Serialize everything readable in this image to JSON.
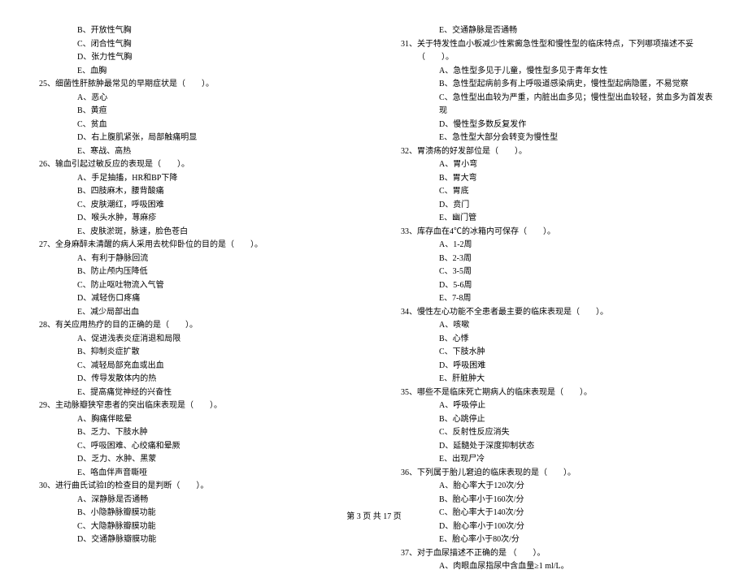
{
  "leftColumn": {
    "preOptions": [
      "B、开放性气胸",
      "C、闭合性气胸",
      "D、张力性气胸",
      "E、血胸"
    ],
    "questions": [
      {
        "num": "25、",
        "stem": "细菌性肝脓肿最常见的早期症状是（　　）。",
        "options": [
          "A、恶心",
          "B、黄疸",
          "C、贫血",
          "D、右上腹肌紧张，局部触痛明显",
          "E、寒战、高热"
        ]
      },
      {
        "num": "26、",
        "stem": "输血引起过敏反应的表现是（　　）。",
        "options": [
          "A、手足抽搐，HR和BP下降",
          "B、四肢麻木，腰背酸痛",
          "C、皮肤潮红，呼吸困难",
          "D、喉头水肿，荨麻疹",
          "E、皮肤淤斑，脉速，脸色苍白"
        ]
      },
      {
        "num": "27、",
        "stem": "全身麻醉未清醒的病人采用去枕仰卧位的目的是（　　）。",
        "options": [
          "A、有利于静脉回流",
          "B、防止颅内压降低",
          "C、防止呕吐物流入气管",
          "D、减轻伤口疼痛",
          "E、减少局部出血"
        ]
      },
      {
        "num": "28、",
        "stem": "有关应用热疗的目的正确的是（　　）。",
        "options": [
          "A、促进浅表炎症消退和局限",
          "B、抑制炎症扩散",
          "C、减轻局部充血或出血",
          "D、传导发散体内的热",
          "E、提高痛觉神经的兴奋性"
        ]
      },
      {
        "num": "29、",
        "stem": "主动脉瓣狭窄患者的突出临床表现是（　　）。",
        "options": [
          "A、胸痛伴眩晕",
          "B、乏力、下肢水肿",
          "C、呼吸困难、心绞痛和晕厥",
          "D、乏力、水肿、黑蒙",
          "E、咯血伴声音嘶哑"
        ]
      },
      {
        "num": "30、",
        "stem": "进行曲氏试验I的检查目的是判断（　　）。",
        "options": [
          "A、深静脉是否通畅",
          "B、小隐静脉瓣膜功能",
          "C、大隐静脉瓣膜功能",
          "D、交通静脉瓣膜功能"
        ]
      }
    ]
  },
  "rightColumn": {
    "preOptions": [
      "E、交通静脉是否通畅"
    ],
    "questions": [
      {
        "num": "31、",
        "stem": "关于特发性血小板减少性紫癜急性型和慢性型的临床特点，下列哪项描述不妥（　　）。",
        "options": [
          "A、急性型多见于儿童，慢性型多见于青年女性",
          "B、急性型起病前多有上呼吸道感染病史，慢性型起病隐匿，不易觉察",
          "C、急性型出血较为严重，内脏出血多见；慢性型出血较轻，贫血多为首发表现",
          "D、慢性型多数反复发作",
          "E、急性型大部分会转变为慢性型"
        ]
      },
      {
        "num": "32、",
        "stem": "胃溃疡的好发部位是（　　）。",
        "options": [
          "A、胃小弯",
          "B、胃大弯",
          "C、胃底",
          "D、贲门",
          "E、幽门管"
        ]
      },
      {
        "num": "33、",
        "stem": "库存血在4℃的冰箱内可保存（　　）。",
        "options": [
          "A、1-2周",
          "B、2-3周",
          "C、3-5周",
          "D、5-6周",
          "E、7-8周"
        ]
      },
      {
        "num": "34、",
        "stem": "慢性左心功能不全患者最主要的临床表现是（　　）。",
        "options": [
          "A、咳嗽",
          "B、心悸",
          "C、下肢水肿",
          "D、呼吸困难",
          "E、肝脏肿大"
        ]
      },
      {
        "num": "35、",
        "stem": "哪些不是临床死亡期病人的临床表现是（　　）。",
        "options": [
          "A、呼吸停止",
          "B、心跳停止",
          "C、反射性反应消失",
          "D、延髓处于深度抑制状态",
          "E、出现尸冷"
        ]
      },
      {
        "num": "36、",
        "stem": "下列属于胎儿窘迫的临床表现的是（　　）。",
        "options": [
          "A、胎心率大于120次/分",
          "B、胎心率小于160次/分",
          "C、胎心率大于140次/分",
          "D、胎心率小于100次/分",
          "E、胎心率小于80次/分"
        ]
      },
      {
        "num": "37、",
        "stem": "对于血尿描述不正确的是 （　　）。",
        "options": [
          "A、肉眼血尿指尿中含血量≥1 ml/L。"
        ]
      }
    ]
  },
  "footer": "第 3 页 共 17 页"
}
